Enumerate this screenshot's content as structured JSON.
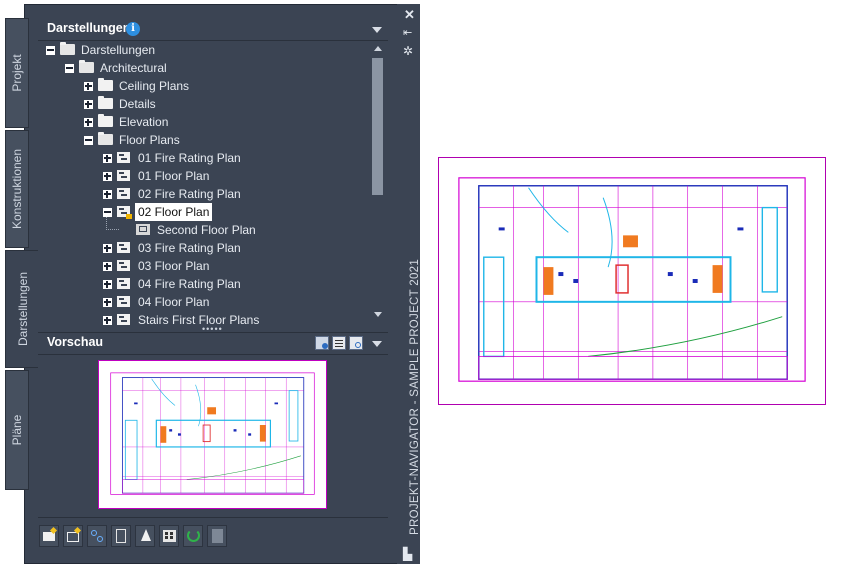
{
  "palette": {
    "title": "Darstellungen",
    "vertical_title": "PROJEKT-NAVIGATOR - SAMPLE PROJECT 2021",
    "side_tabs": [
      {
        "label": "Projekt",
        "active": false
      },
      {
        "label": "Konstruktionen",
        "active": false
      },
      {
        "label": "Darstellungen",
        "active": true
      },
      {
        "label": "Pläne",
        "active": false
      }
    ]
  },
  "tree": {
    "items": [
      {
        "label": "Darstellungen",
        "level": 0,
        "expander": "minus",
        "icon": "folder-open-icon"
      },
      {
        "label": "Architectural",
        "level": 1,
        "expander": "minus",
        "icon": "folder-open-icon"
      },
      {
        "label": "Ceiling Plans",
        "level": 2,
        "expander": "plus",
        "icon": "folder-icon"
      },
      {
        "label": "Details",
        "level": 2,
        "expander": "plus",
        "icon": "folder-icon"
      },
      {
        "label": "Elevation",
        "level": 2,
        "expander": "plus",
        "icon": "folder-icon"
      },
      {
        "label": "Floor Plans",
        "level": 2,
        "expander": "minus",
        "icon": "folder-open-icon"
      },
      {
        "label": "01 Fire Rating Plan",
        "level": 3,
        "expander": "plus",
        "icon": "view-drawing-icon"
      },
      {
        "label": "01 Floor Plan",
        "level": 3,
        "expander": "plus",
        "icon": "view-drawing-icon"
      },
      {
        "label": "02 Fire Rating Plan",
        "level": 3,
        "expander": "plus",
        "icon": "view-drawing-icon"
      },
      {
        "label": "02 Floor Plan",
        "level": 3,
        "expander": "minus",
        "icon": "view-drawing-locked-icon",
        "selected": true
      },
      {
        "label": "Second Floor Plan",
        "level": 4,
        "expander": "none",
        "icon": "model-space-view-icon"
      },
      {
        "label": "03 Fire Rating Plan",
        "level": 3,
        "expander": "plus",
        "icon": "view-drawing-icon"
      },
      {
        "label": "03 Floor Plan",
        "level": 3,
        "expander": "plus",
        "icon": "view-drawing-icon"
      },
      {
        "label": "04 Fire Rating Plan",
        "level": 3,
        "expander": "plus",
        "icon": "view-drawing-icon"
      },
      {
        "label": "04 Floor Plan",
        "level": 3,
        "expander": "plus",
        "icon": "view-drawing-icon"
      },
      {
        "label": "Stairs First Floor Plans",
        "level": 3,
        "expander": "plus",
        "icon": "view-drawing-icon"
      }
    ]
  },
  "preview": {
    "title": "Vorschau",
    "header_icons": [
      "refresh-preview-icon",
      "details-icon",
      "preview-zoom-icon"
    ]
  },
  "toolbar": {
    "buttons": [
      "new-category-icon",
      "new-view-icon",
      "new-view-link-icon",
      "repath-icon",
      "xref-icon",
      "properties-grid-icon",
      "refresh-icon",
      "regenerate-icon"
    ]
  },
  "right_strip": {
    "icons": [
      "close-icon",
      "auto-hide-icon",
      "settings-icon"
    ]
  },
  "colors": {
    "panel_bg": "#3b4453",
    "drawing_border": "#b000b0",
    "plan_magenta": "#d400d4",
    "plan_cyan": "#1fb6e8",
    "plan_blue": "#1a2bb8",
    "plan_orange": "#f07a20",
    "plan_green": "#20a040"
  }
}
